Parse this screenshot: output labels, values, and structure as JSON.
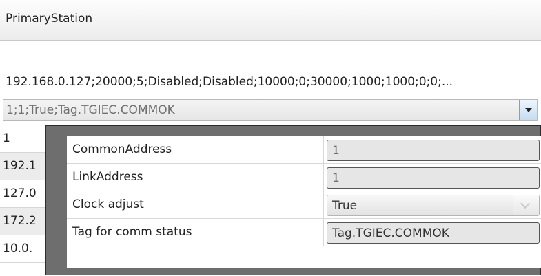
{
  "header": {
    "title": "PrimaryStation"
  },
  "rows": {
    "ip_config": "192.168.0.127;20000;5;Disabled;Disabled;10000;0;30000;1000;1000;0;0;...",
    "combo_value": "1;1;True;Tag.TGIEC.COMMOK"
  },
  "left_column": [
    "1",
    "192.1",
    "127.0",
    "172.2",
    "10.0."
  ],
  "popup": {
    "properties": [
      {
        "label": "CommonAddress",
        "value": "1"
      },
      {
        "label": "LinkAddress",
        "value": "1"
      },
      {
        "label": "Clock adjust",
        "value": "True"
      },
      {
        "label": "Tag for comm status",
        "value": "Tag.TGIEC.COMMOK"
      }
    ]
  },
  "icons": {
    "combo_dropdown": "chevron-down-icon",
    "clock_dropdown": "chevron-down-icon"
  }
}
